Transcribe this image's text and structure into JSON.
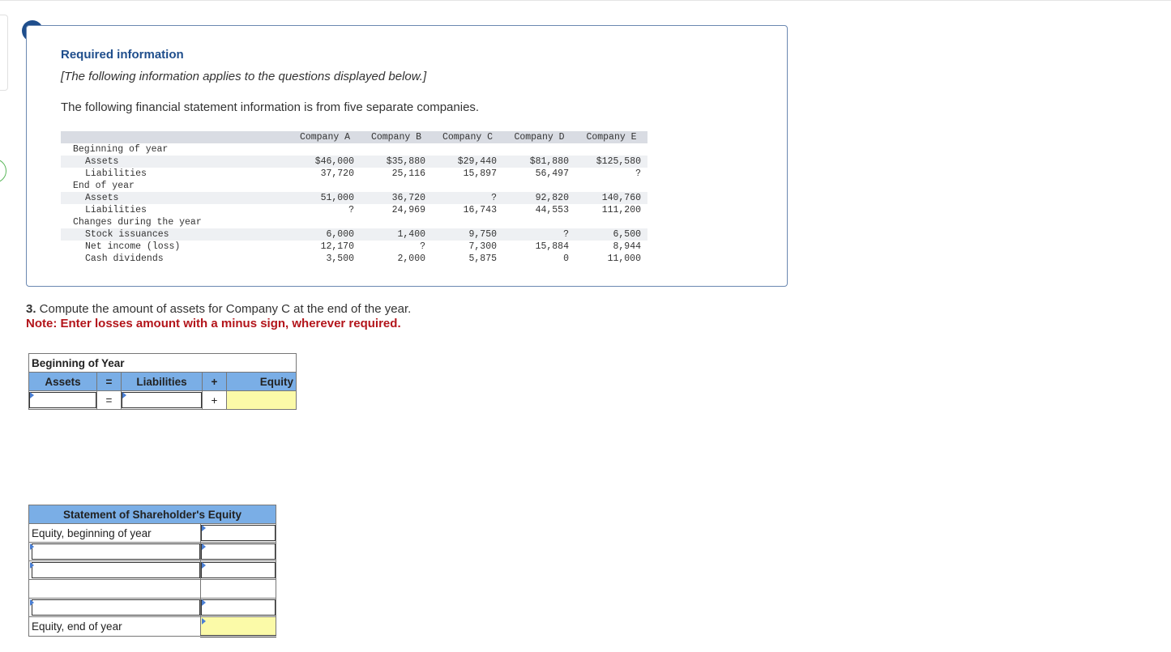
{
  "alert_icon": "!",
  "info": {
    "title": "Required information",
    "note": "[The following information applies to the questions displayed below.]",
    "description": "The following financial statement information is from five separate companies."
  },
  "table": {
    "headers": [
      "Company A",
      "Company B",
      "Company C",
      "Company D",
      "Company E"
    ],
    "rows": [
      {
        "label": "Beginning of year",
        "indent": 1,
        "values": [
          "",
          "",
          "",
          "",
          ""
        ]
      },
      {
        "label": "Assets",
        "indent": 2,
        "values": [
          "$46,000",
          "$35,880",
          "$29,440",
          "$81,880",
          "$125,580"
        ]
      },
      {
        "label": "Liabilities",
        "indent": 2,
        "values": [
          "37,720",
          "25,116",
          "15,897",
          "56,497",
          "?"
        ]
      },
      {
        "label": "End of year",
        "indent": 1,
        "values": [
          "",
          "",
          "",
          "",
          ""
        ]
      },
      {
        "label": "Assets",
        "indent": 2,
        "values": [
          "51,000",
          "36,720",
          "?",
          "92,820",
          "140,760"
        ]
      },
      {
        "label": "Liabilities",
        "indent": 2,
        "values": [
          "?",
          "24,969",
          "16,743",
          "44,553",
          "111,200"
        ]
      },
      {
        "label": "Changes during the year",
        "indent": 1,
        "values": [
          "",
          "",
          "",
          "",
          ""
        ]
      },
      {
        "label": "Stock issuances",
        "indent": 2,
        "values": [
          "6,000",
          "1,400",
          "9,750",
          "?",
          "6,500"
        ]
      },
      {
        "label": "Net income (loss)",
        "indent": 2,
        "values": [
          "12,170",
          "?",
          "7,300",
          "15,884",
          "8,944"
        ]
      },
      {
        "label": "Cash dividends",
        "indent": 2,
        "values": [
          "3,500",
          "2,000",
          "5,875",
          "0",
          "11,000"
        ]
      }
    ]
  },
  "question": {
    "number": "3.",
    "text": " Compute the amount of assets for Company C at the end of the year.",
    "note": "Note: Enter losses amount with a minus sign, wherever required."
  },
  "equation": {
    "caption": "Beginning of Year",
    "assets": "Assets",
    "eq": "=",
    "liabilities": "Liabilities",
    "plus": "+",
    "equity": "Equity"
  },
  "soe": {
    "title": "Statement of Shareholder's Equity",
    "begin_label": "Equity, beginning of year",
    "end_label": "Equity, end of year"
  }
}
